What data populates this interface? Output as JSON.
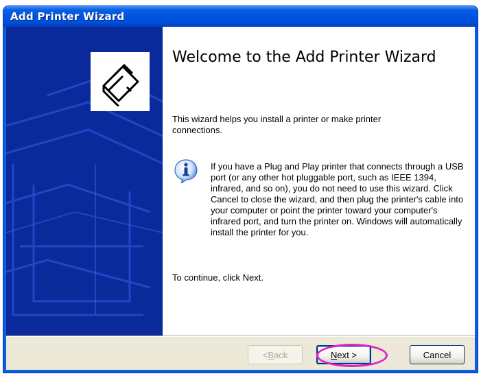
{
  "window": {
    "title": "Add Printer Wizard"
  },
  "main": {
    "heading": "Welcome to the Add Printer Wizard",
    "intro": "This wizard helps you install a printer or make printer connections.",
    "info_text": "If you have a Plug and Play printer that connects through a USB port (or any other hot pluggable port, such as IEEE 1394, infrared, and so on), you do not need to use this wizard. Click Cancel to close the wizard, and then plug the printer's cable into your computer or point the printer toward your computer's infrared port, and turn the printer on. Windows will automatically install the printer for you.",
    "continue_text": "To continue, click Next.",
    "info_icon": "info-icon",
    "wizard_icon": "printer-icon"
  },
  "buttons": {
    "back_prefix": "< ",
    "back_key": "B",
    "back_rest": "ack",
    "next_key": "N",
    "next_rest": "ext >",
    "cancel": "Cancel"
  },
  "colors": {
    "titlebar": "#0054e3",
    "sidebar": "#0a2a9c",
    "highlight": "#e020c8"
  }
}
